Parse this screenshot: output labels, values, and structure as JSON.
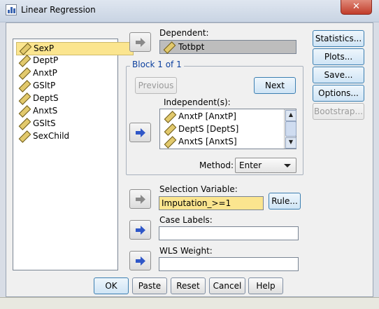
{
  "window": {
    "title": "Linear Regression",
    "close_glyph": "✕"
  },
  "variable_list": {
    "items": [
      {
        "label": "SexP",
        "selected": true
      },
      {
        "label": "DeptP",
        "selected": false
      },
      {
        "label": "AnxtP",
        "selected": false
      },
      {
        "label": "GSltP",
        "selected": false
      },
      {
        "label": "DeptS",
        "selected": false
      },
      {
        "label": "AnxtS",
        "selected": false
      },
      {
        "label": "GSltS",
        "selected": false
      },
      {
        "label": "SexChild",
        "selected": false
      }
    ]
  },
  "dependent": {
    "label": "Dependent:",
    "value": "Totbpt"
  },
  "block": {
    "title": "Block 1 of 1",
    "previous_label": "Previous",
    "next_label": "Next"
  },
  "independents": {
    "label": "Independent(s):",
    "items": [
      "AnxtP [AnxtP]",
      "DeptS [DeptS]",
      "AnxtS [AnxtS]"
    ]
  },
  "method": {
    "label": "Method:",
    "value": "Enter"
  },
  "selection": {
    "label": "Selection Variable:",
    "value": "Imputation_>=1",
    "rule_label": "Rule..."
  },
  "case_labels": {
    "label": "Case Labels:",
    "value": ""
  },
  "wls_weight": {
    "label": "WLS Weight:",
    "value": ""
  },
  "side_buttons": {
    "statistics": "Statistics...",
    "plots": "Plots...",
    "save": "Save...",
    "options": "Options...",
    "bootstrap": "Bootstrap..."
  },
  "bottom_buttons": {
    "ok": "OK",
    "paste": "Paste",
    "reset": "Reset",
    "cancel": "Cancel",
    "help": "Help"
  },
  "colors": {
    "selected_bg": "#fbe58f",
    "group_title": "#0b3f9e",
    "arrow_enabled": "#2f57c8",
    "arrow_disabled": "#8a8a8a"
  }
}
